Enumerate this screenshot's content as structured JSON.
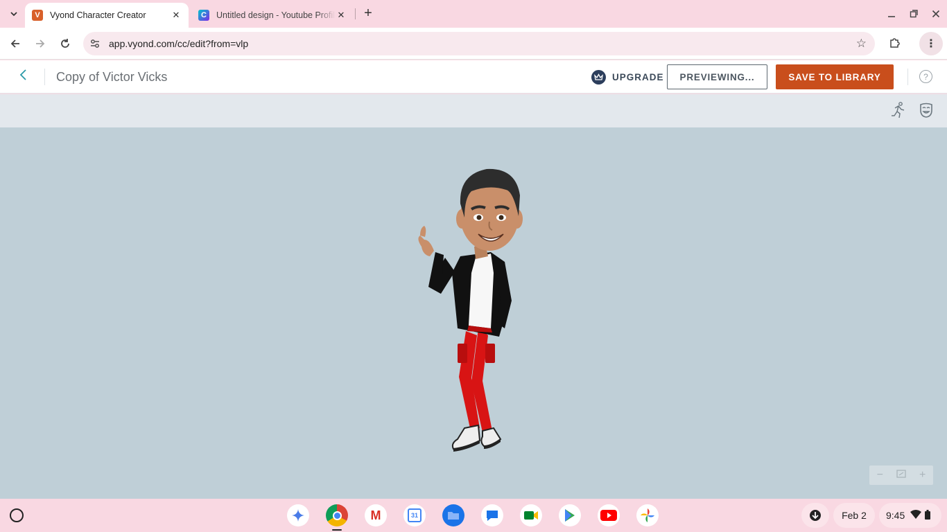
{
  "browser": {
    "tabs": [
      {
        "title": "Vyond Character Creator",
        "favicon": "V",
        "active": true
      },
      {
        "title": "Untitled design - Youtube Profile",
        "favicon": "C",
        "active": false
      }
    ],
    "url": "app.vyond.com/cc/edit?from=vlp"
  },
  "header": {
    "title": "Copy of Victor Vicks",
    "upgrade_label": "UPGRADE",
    "preview_label": "PREVIEWING...",
    "save_label": "SAVE TO LIBRARY"
  },
  "colors": {
    "accent": "#c94e1c",
    "stage_bg": "#bfcfd7",
    "back_chevron": "#2a9aa8"
  },
  "shelf": {
    "apps": [
      {
        "name": "gemini",
        "label": ""
      },
      {
        "name": "chrome",
        "label": ""
      },
      {
        "name": "gmail",
        "label": "M"
      },
      {
        "name": "calendar",
        "label": "31"
      },
      {
        "name": "files",
        "label": ""
      },
      {
        "name": "messages",
        "label": ""
      },
      {
        "name": "meet",
        "label": ""
      },
      {
        "name": "play-store",
        "label": ""
      },
      {
        "name": "youtube",
        "label": ""
      },
      {
        "name": "photos",
        "label": ""
      }
    ],
    "date": "Feb 2",
    "time": "9:45"
  }
}
